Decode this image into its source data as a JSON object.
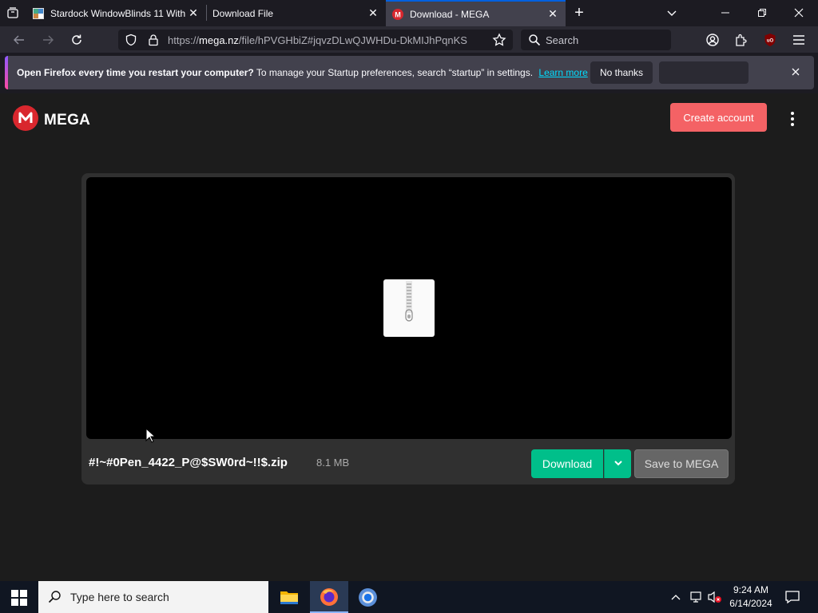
{
  "browser": {
    "tabs": [
      {
        "title": "Stardock WindowBlinds 11 With",
        "active": false
      },
      {
        "title": "Download File",
        "active": false
      },
      {
        "title": "Download - MEGA",
        "active": true
      }
    ],
    "url": "https://mega.nz/file/hPVGHbiZ#jqvzDLwQJWHDu-DkMIJhPqnKS",
    "url_domain": "mega.nz",
    "url_prefix": "https://",
    "url_rest": "/file/hPVGHbiZ#jqvzDLwQJWHDu-DkMIJhPqnKS",
    "search_placeholder": "Search"
  },
  "notification": {
    "bold": "Open Firefox every time you restart your computer?",
    "text": " To manage your Startup preferences, search “startup” in settings.",
    "link": "Learn more",
    "no_thanks": "No thanks"
  },
  "mega": {
    "brand": "MEGA",
    "create_account": "Create account",
    "file_name": "#!~#0Pen_4422_P@$SW0rd~!!$.zip",
    "file_size": "8.1 MB",
    "download": "Download",
    "save_to_mega": "Save to MEGA"
  },
  "taskbar": {
    "search_placeholder": "Type here to search",
    "time": "9:24 AM",
    "date": "6/14/2024"
  },
  "colors": {
    "accent": "#0060df",
    "mega_red": "#d9272e",
    "create": "#f46265",
    "download": "#00bf8a"
  }
}
